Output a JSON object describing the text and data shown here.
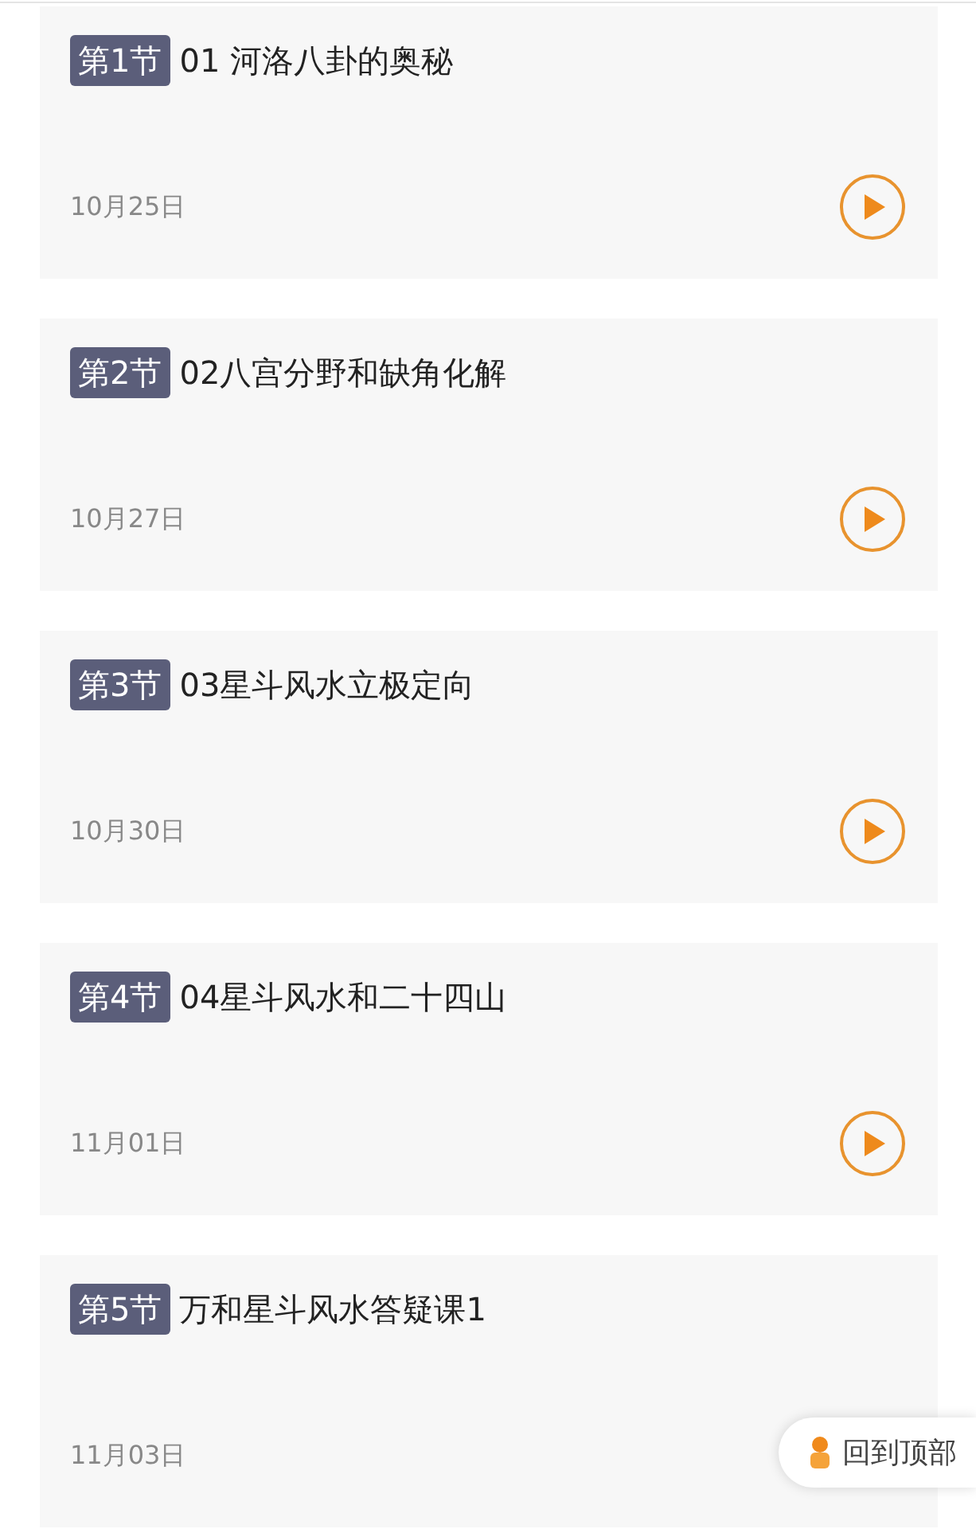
{
  "lessons": [
    {
      "badge": "第1节",
      "title": "01 河洛八卦的奥秘",
      "date": "10月25日",
      "play": true
    },
    {
      "badge": "第2节",
      "title": "02八宫分野和缺角化解",
      "date": "10月27日",
      "play": true
    },
    {
      "badge": "第3节",
      "title": "03星斗风水立极定向",
      "date": "10月30日",
      "play": true
    },
    {
      "badge": "第4节",
      "title": "04星斗风水和二十四山",
      "date": "11月01日",
      "play": true
    },
    {
      "badge": "第5节",
      "title": "万和星斗风水答疑课1",
      "date": "11月03日",
      "play": false
    }
  ],
  "back_to_top": {
    "label": "回到顶部"
  }
}
